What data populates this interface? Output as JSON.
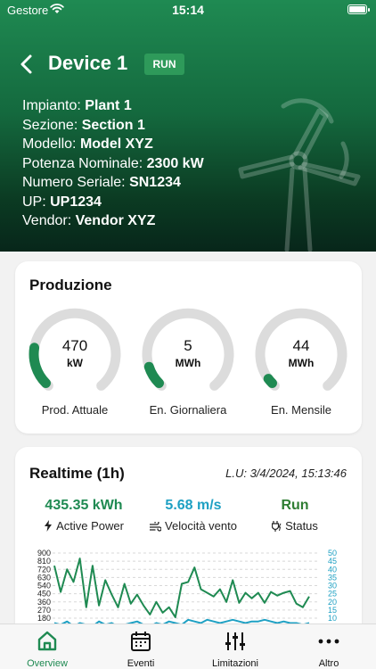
{
  "status_bar": {
    "carrier": "Gestore",
    "time": "15:14"
  },
  "header": {
    "title": "Device 1",
    "badge": "RUN",
    "rows": [
      {
        "label": "Impianto:",
        "value": "Plant 1"
      },
      {
        "label": "Sezione:",
        "value": "Section 1"
      },
      {
        "label": "Modello:",
        "value": "Model XYZ"
      },
      {
        "label": "Potenza Nominale:",
        "value": "2300 kW"
      },
      {
        "label": "Numero Seriale:",
        "value": "SN1234"
      },
      {
        "label": "UP:",
        "value": "UP1234"
      },
      {
        "label": "Vendor:",
        "value": "Vendor XYZ"
      }
    ]
  },
  "production": {
    "title": "Produzione",
    "gauges": [
      {
        "value": "470",
        "unit": "kW",
        "label": "Prod. Attuale",
        "fraction": 0.2
      },
      {
        "value": "5",
        "unit": "MWh",
        "label": "En. Giornaliera",
        "fraction": 0.1
      },
      {
        "value": "44",
        "unit": "MWh",
        "label": "En. Mensile",
        "fraction": 0.03
      }
    ]
  },
  "realtime": {
    "title": "Realtime (1h)",
    "last_update": "L.U: 3/4/2024, 15:13:46",
    "kpis": [
      {
        "value": "435.35 kWh",
        "label": "Active Power",
        "icon": "bolt-icon",
        "color": "#1f8a52"
      },
      {
        "value": "5.68 m/s",
        "label": "Velocità vento",
        "icon": "wind-icon",
        "color": "#1ea0c3"
      },
      {
        "value": "Run",
        "label": "Status",
        "icon": "plug-bolt-icon",
        "color": "#2e7d32"
      }
    ]
  },
  "chart_data": {
    "type": "line",
    "left_ticks": [
      "900",
      "810",
      "720",
      "630",
      "540",
      "450",
      "360",
      "270",
      "180"
    ],
    "right_ticks": [
      "50",
      "45",
      "40",
      "35",
      "30",
      "25",
      "20",
      "15",
      "10"
    ],
    "left_ylim": [
      180,
      900
    ],
    "right_ylim": [
      10,
      50
    ],
    "series": [
      {
        "axis": "left",
        "color": "#1f8a52",
        "values": [
          760,
          470,
          720,
          580,
          840,
          300,
          760,
          320,
          600,
          440,
          300,
          560,
          340,
          440,
          320,
          220,
          360,
          240,
          300,
          190,
          560,
          580,
          740,
          500,
          460,
          420,
          500,
          360,
          600,
          350,
          460,
          400,
          460,
          350,
          470,
          430,
          460,
          480,
          340,
          300,
          420
        ]
      },
      {
        "axis": "right",
        "color": "#1ea0c3",
        "values": [
          7,
          6,
          8,
          5,
          7,
          6,
          5,
          8,
          6,
          7,
          5,
          6,
          7,
          8,
          6,
          5,
          7,
          6,
          8,
          7,
          6,
          9,
          8,
          7,
          9,
          8,
          7,
          8,
          9,
          8,
          7,
          8,
          8,
          9,
          8,
          7,
          8,
          7,
          7,
          6,
          7
        ]
      }
    ]
  },
  "tabs": [
    {
      "label": "Overview",
      "icon": "home-icon",
      "active": true
    },
    {
      "label": "Eventi",
      "icon": "calendar-icon",
      "active": false
    },
    {
      "label": "Limitazioni",
      "icon": "sliders-icon",
      "active": false
    },
    {
      "label": "Altro",
      "icon": "more-icon",
      "active": false
    }
  ],
  "colors": {
    "accent": "#1f8a52",
    "wind": "#1ea0c3",
    "gauge_track": "#dcdcdc"
  }
}
